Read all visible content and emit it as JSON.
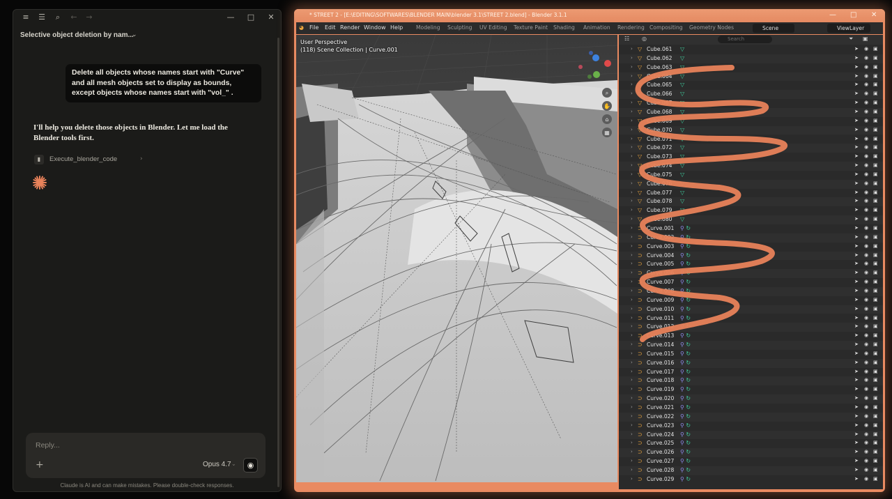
{
  "chat": {
    "toolbar": {
      "menu": "≡",
      "sidebar": "☰",
      "search": "⌕",
      "back": "←",
      "forward": "→",
      "minimize": "—",
      "maximize": "□",
      "close": "✕"
    },
    "conversation_title": "Selective object deletion by nam...",
    "user_message": "Delete all objects whose names start with \"Curve\" and all mesh objects set to display as bounds, except objects whose names start with \"vol_\" .",
    "assistant_message": "I'll help you delete those objects in Blender. Let me load the Blender tools first.",
    "tool_call": {
      "icon": "code-icon",
      "label": "Execute_blender_code"
    },
    "composer": {
      "placeholder": "Reply...",
      "add": "+",
      "model": "Opus 4.7"
    },
    "disclaimer": "Claude is AI and can make mistakes. Please double-check responses.",
    "accent_color": "#e8825a"
  },
  "blender": {
    "title": "* STREET 2 - [E:\\EDITING\\SOFTWARES\\BLENDER MAIN\\blender 3.1\\STREET 2.blend] - Blender 3.1.1",
    "menu": [
      "File",
      "Edit",
      "Render",
      "Window",
      "Help"
    ],
    "workspaces": [
      "Modeling",
      "Sculpting",
      "UV Editing",
      "Texture Paint",
      "Shading",
      "Animation",
      "Rendering",
      "Compositing",
      "Geometry Nodes"
    ],
    "scene": "Scene",
    "view_layer": "ViewLayer",
    "viewport": {
      "perspective": "User Perspective",
      "collection": "(118) Scene Collection | Curve.001"
    },
    "outliner": {
      "search_placeholder": "Search",
      "rows": [
        {
          "name": "Cube.061",
          "type": "mesh"
        },
        {
          "name": "Cube.062",
          "type": "mesh"
        },
        {
          "name": "Cube.063",
          "type": "mesh"
        },
        {
          "name": "Cube.064",
          "type": "mesh"
        },
        {
          "name": "Cube.065",
          "type": "mesh"
        },
        {
          "name": "Cube.066",
          "type": "mesh"
        },
        {
          "name": "Cube.067",
          "type": "mesh"
        },
        {
          "name": "Cube.068",
          "type": "mesh"
        },
        {
          "name": "Cube.069",
          "type": "mesh"
        },
        {
          "name": "Cube.070",
          "type": "mesh"
        },
        {
          "name": "Cube.071",
          "type": "mesh"
        },
        {
          "name": "Cube.072",
          "type": "mesh"
        },
        {
          "name": "Cube.073",
          "type": "mesh"
        },
        {
          "name": "Cube.074",
          "type": "mesh"
        },
        {
          "name": "Cube.075",
          "type": "mesh"
        },
        {
          "name": "Cube.076",
          "type": "mesh"
        },
        {
          "name": "Cube.077",
          "type": "mesh"
        },
        {
          "name": "Cube.078",
          "type": "mesh"
        },
        {
          "name": "Cube.079",
          "type": "mesh"
        },
        {
          "name": "Cube.080",
          "type": "mesh"
        },
        {
          "name": "Curve.001",
          "type": "curve"
        },
        {
          "name": "Curve.002",
          "type": "curve"
        },
        {
          "name": "Curve.003",
          "type": "curve"
        },
        {
          "name": "Curve.004",
          "type": "curve"
        },
        {
          "name": "Curve.005",
          "type": "curve"
        },
        {
          "name": "Curve.006",
          "type": "curve"
        },
        {
          "name": "Curve.007",
          "type": "curve"
        },
        {
          "name": "Curve.008",
          "type": "curve"
        },
        {
          "name": "Curve.009",
          "type": "curve"
        },
        {
          "name": "Curve.010",
          "type": "curve"
        },
        {
          "name": "Curve.011",
          "type": "curve"
        },
        {
          "name": "Curve.012",
          "type": "curve"
        },
        {
          "name": "Curve.013",
          "type": "curve"
        },
        {
          "name": "Curve.014",
          "type": "curve"
        },
        {
          "name": "Curve.015",
          "type": "curve"
        },
        {
          "name": "Curve.016",
          "type": "curve"
        },
        {
          "name": "Curve.017",
          "type": "curve"
        },
        {
          "name": "Curve.018",
          "type": "curve"
        },
        {
          "name": "Curve.019",
          "type": "curve"
        },
        {
          "name": "Curve.020",
          "type": "curve"
        },
        {
          "name": "Curve.021",
          "type": "curve"
        },
        {
          "name": "Curve.022",
          "type": "curve"
        },
        {
          "name": "Curve.023",
          "type": "curve"
        },
        {
          "name": "Curve.024",
          "type": "curve"
        },
        {
          "name": "Curve.025",
          "type": "curve"
        },
        {
          "name": "Curve.026",
          "type": "curve"
        },
        {
          "name": "Curve.027",
          "type": "curve"
        },
        {
          "name": "Curve.028",
          "type": "curve"
        },
        {
          "name": "Curve.029",
          "type": "curve"
        }
      ]
    },
    "colors": {
      "mesh_icon": "#e8a33d",
      "mesh_data": "#3fd1a0",
      "curve_data": "#8f8cf0",
      "modifier": "#3fd1a0",
      "scribble": "#e8825a"
    }
  }
}
